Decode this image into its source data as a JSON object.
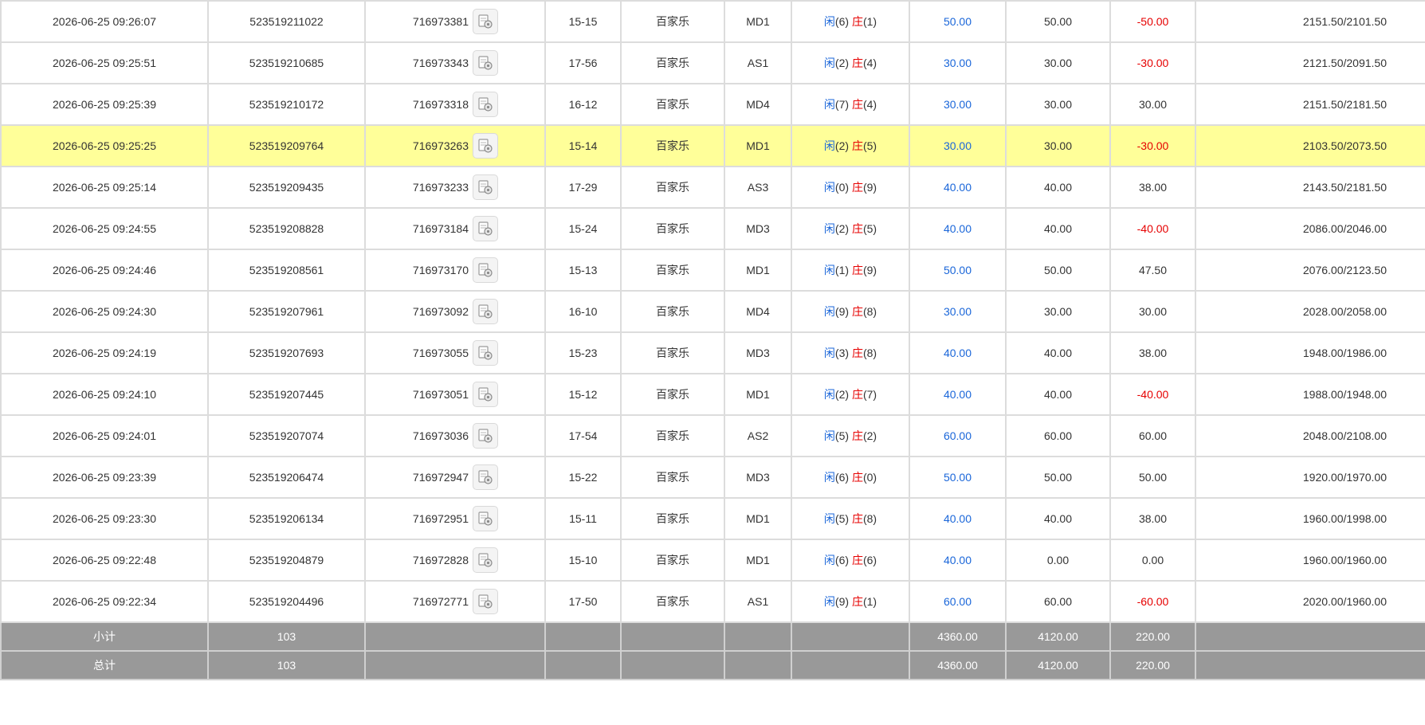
{
  "colors": {
    "player": "#1a66d9",
    "banker": "#e60000",
    "loss": "#e60000",
    "highlight": "#ffff99",
    "summary_bg": "#999999"
  },
  "icons": {
    "record": "game-record-icon"
  },
  "rows": [
    {
      "time": "2026-06-25 09:26:07",
      "bet_id": "523519211022",
      "game_id": "716973381",
      "table": "15-15",
      "game": "百家乐",
      "type": "MD1",
      "p_label": "闲",
      "p_val": "(6)",
      "b_label": "庄",
      "b_val": "(1)",
      "bet": "50.00",
      "valid": "50.00",
      "win": "-50.00",
      "loss": true,
      "balance": "2151.50/2101.50"
    },
    {
      "time": "2026-06-25 09:25:51",
      "bet_id": "523519210685",
      "game_id": "716973343",
      "table": "17-56",
      "game": "百家乐",
      "type": "AS1",
      "p_label": "闲",
      "p_val": "(2)",
      "b_label": "庄",
      "b_val": "(4)",
      "bet": "30.00",
      "valid": "30.00",
      "win": "-30.00",
      "loss": true,
      "balance": "2121.50/2091.50"
    },
    {
      "time": "2026-06-25 09:25:39",
      "bet_id": "523519210172",
      "game_id": "716973318",
      "table": "16-12",
      "game": "百家乐",
      "type": "MD4",
      "p_label": "闲",
      "p_val": "(7)",
      "b_label": "庄",
      "b_val": "(4)",
      "bet": "30.00",
      "valid": "30.00",
      "win": "30.00",
      "loss": false,
      "balance": "2151.50/2181.50"
    },
    {
      "time": "2026-06-25 09:25:25",
      "bet_id": "523519209764",
      "game_id": "716973263",
      "table": "15-14",
      "game": "百家乐",
      "type": "MD1",
      "p_label": "闲",
      "p_val": "(2)",
      "b_label": "庄",
      "b_val": "(5)",
      "bet": "30.00",
      "valid": "30.00",
      "win": "-30.00",
      "loss": true,
      "balance": "2103.50/2073.50",
      "highlight": true
    },
    {
      "time": "2026-06-25 09:25:14",
      "bet_id": "523519209435",
      "game_id": "716973233",
      "table": "17-29",
      "game": "百家乐",
      "type": "AS3",
      "p_label": "闲",
      "p_val": "(0)",
      "b_label": "庄",
      "b_val": "(9)",
      "bet": "40.00",
      "valid": "40.00",
      "win": "38.00",
      "loss": false,
      "balance": "2143.50/2181.50"
    },
    {
      "time": "2026-06-25 09:24:55",
      "bet_id": "523519208828",
      "game_id": "716973184",
      "table": "15-24",
      "game": "百家乐",
      "type": "MD3",
      "p_label": "闲",
      "p_val": "(2)",
      "b_label": "庄",
      "b_val": "(5)",
      "bet": "40.00",
      "valid": "40.00",
      "win": "-40.00",
      "loss": true,
      "balance": "2086.00/2046.00"
    },
    {
      "time": "2026-06-25 09:24:46",
      "bet_id": "523519208561",
      "game_id": "716973170",
      "table": "15-13",
      "game": "百家乐",
      "type": "MD1",
      "p_label": "闲",
      "p_val": "(1)",
      "b_label": "庄",
      "b_val": "(9)",
      "bet": "50.00",
      "valid": "50.00",
      "win": "47.50",
      "loss": false,
      "balance": "2076.00/2123.50"
    },
    {
      "time": "2026-06-25 09:24:30",
      "bet_id": "523519207961",
      "game_id": "716973092",
      "table": "16-10",
      "game": "百家乐",
      "type": "MD4",
      "p_label": "闲",
      "p_val": "(9)",
      "b_label": "庄",
      "b_val": "(8)",
      "bet": "30.00",
      "valid": "30.00",
      "win": "30.00",
      "loss": false,
      "balance": "2028.00/2058.00"
    },
    {
      "time": "2026-06-25 09:24:19",
      "bet_id": "523519207693",
      "game_id": "716973055",
      "table": "15-23",
      "game": "百家乐",
      "type": "MD3",
      "p_label": "闲",
      "p_val": "(3)",
      "b_label": "庄",
      "b_val": "(8)",
      "bet": "40.00",
      "valid": "40.00",
      "win": "38.00",
      "loss": false,
      "balance": "1948.00/1986.00"
    },
    {
      "time": "2026-06-25 09:24:10",
      "bet_id": "523519207445",
      "game_id": "716973051",
      "table": "15-12",
      "game": "百家乐",
      "type": "MD1",
      "p_label": "闲",
      "p_val": "(2)",
      "b_label": "庄",
      "b_val": "(7)",
      "bet": "40.00",
      "valid": "40.00",
      "win": "-40.00",
      "loss": true,
      "balance": "1988.00/1948.00"
    },
    {
      "time": "2026-06-25 09:24:01",
      "bet_id": "523519207074",
      "game_id": "716973036",
      "table": "17-54",
      "game": "百家乐",
      "type": "AS2",
      "p_label": "闲",
      "p_val": "(5)",
      "b_label": "庄",
      "b_val": "(2)",
      "bet": "60.00",
      "valid": "60.00",
      "win": "60.00",
      "loss": false,
      "balance": "2048.00/2108.00"
    },
    {
      "time": "2026-06-25 09:23:39",
      "bet_id": "523519206474",
      "game_id": "716972947",
      "table": "15-22",
      "game": "百家乐",
      "type": "MD3",
      "p_label": "闲",
      "p_val": "(6)",
      "b_label": "庄",
      "b_val": "(0)",
      "bet": "50.00",
      "valid": "50.00",
      "win": "50.00",
      "loss": false,
      "balance": "1920.00/1970.00"
    },
    {
      "time": "2026-06-25 09:23:30",
      "bet_id": "523519206134",
      "game_id": "716972951",
      "table": "15-11",
      "game": "百家乐",
      "type": "MD1",
      "p_label": "闲",
      "p_val": "(5)",
      "b_label": "庄",
      "b_val": "(8)",
      "bet": "40.00",
      "valid": "40.00",
      "win": "38.00",
      "loss": false,
      "balance": "1960.00/1998.00"
    },
    {
      "time": "2026-06-25 09:22:48",
      "bet_id": "523519204879",
      "game_id": "716972828",
      "table": "15-10",
      "game": "百家乐",
      "type": "MD1",
      "p_label": "闲",
      "p_val": "(6)",
      "b_label": "庄",
      "b_val": "(6)",
      "bet": "40.00",
      "valid": "0.00",
      "win": "0.00",
      "loss": false,
      "balance": "1960.00/1960.00"
    },
    {
      "time": "2026-06-25 09:22:34",
      "bet_id": "523519204496",
      "game_id": "716972771",
      "table": "17-50",
      "game": "百家乐",
      "type": "AS1",
      "p_label": "闲",
      "p_val": "(9)",
      "b_label": "庄",
      "b_val": "(1)",
      "bet": "60.00",
      "valid": "60.00",
      "win": "-60.00",
      "loss": true,
      "balance": "2020.00/1960.00"
    }
  ],
  "summary": [
    {
      "label": "小计",
      "count": "103",
      "bet": "4360.00",
      "valid": "4120.00",
      "win": "220.00"
    },
    {
      "label": "总计",
      "count": "103",
      "bet": "4360.00",
      "valid": "4120.00",
      "win": "220.00"
    }
  ]
}
